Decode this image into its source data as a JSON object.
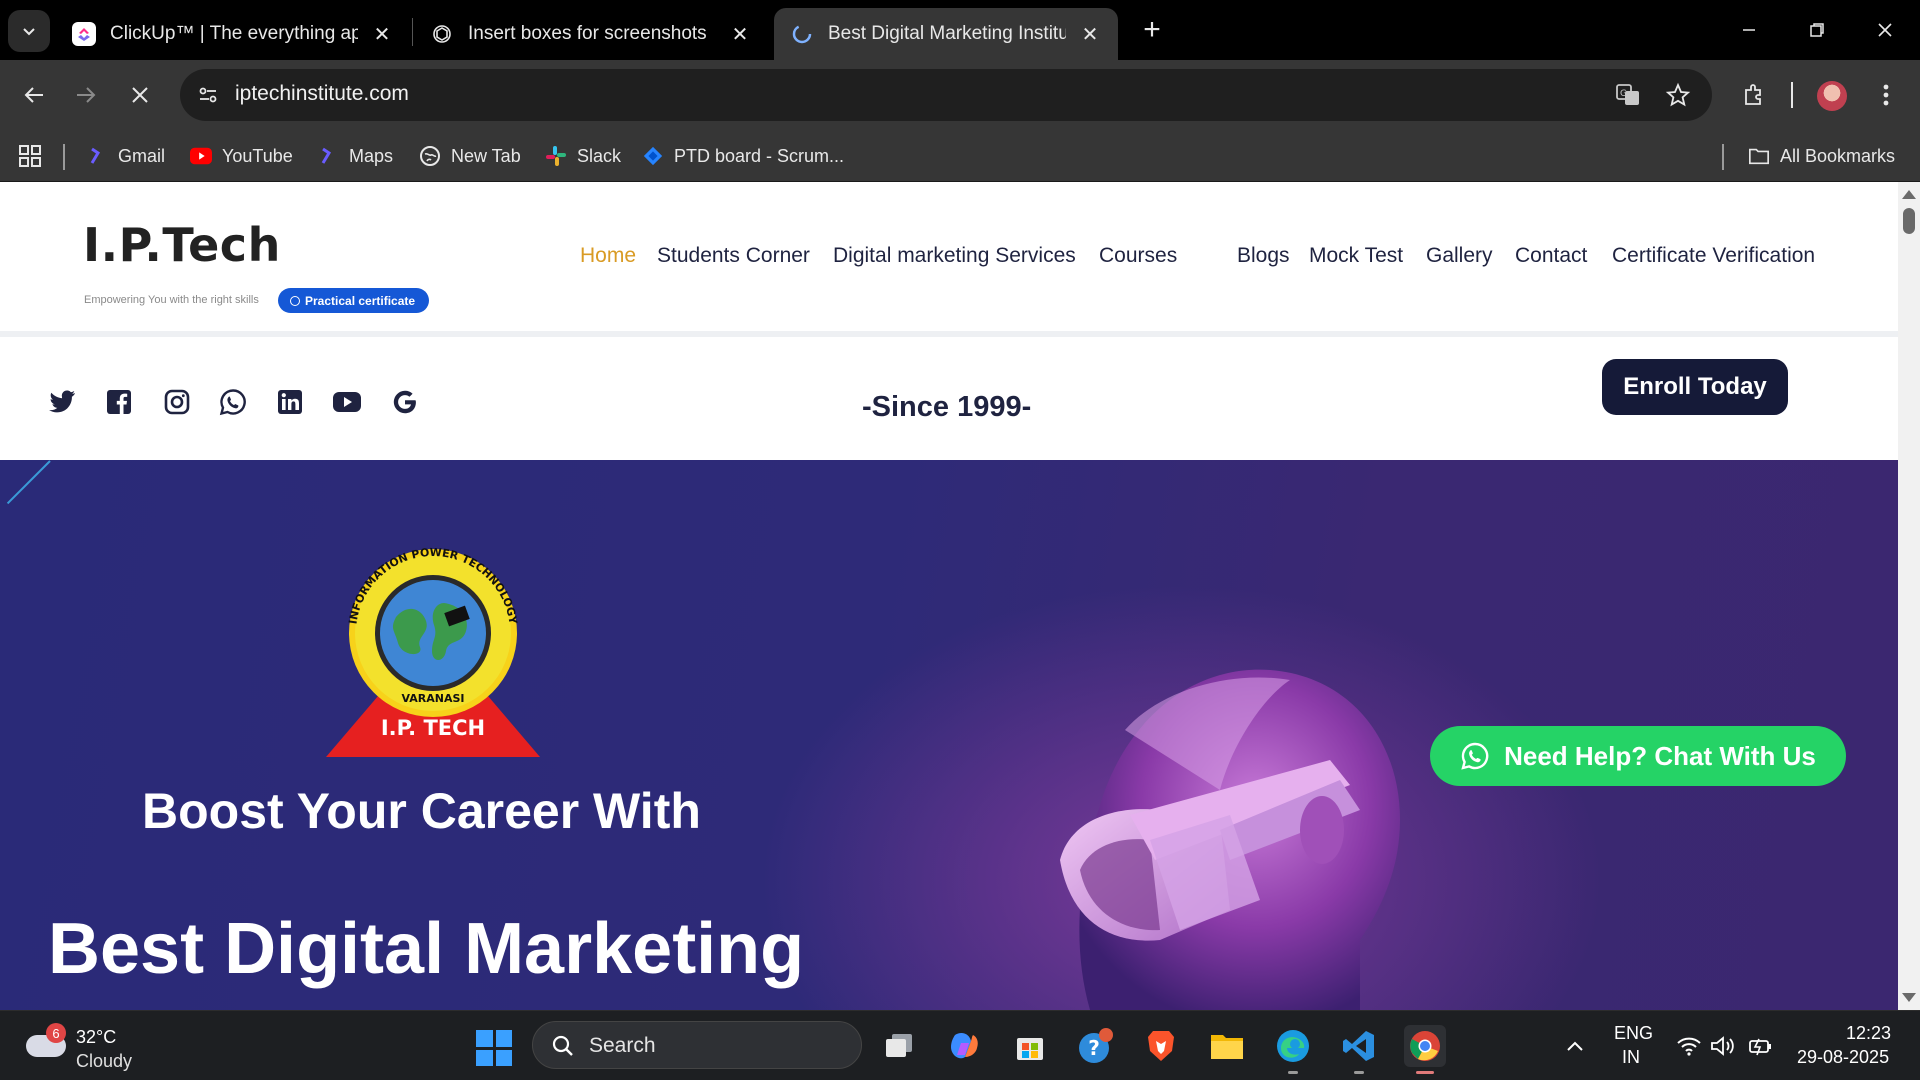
{
  "browser": {
    "tabs": [
      {
        "title": "ClickUp™ | The everything app f",
        "active": false
      },
      {
        "title": "Insert boxes for screenshots",
        "active": false
      },
      {
        "title": "Best Digital Marketing Institute",
        "active": true
      }
    ],
    "url": "iptechinstitute.com",
    "bookmarks": [
      {
        "label": "Gmail",
        "icon": "gmail-icon"
      },
      {
        "label": "YouTube",
        "icon": "youtube-icon"
      },
      {
        "label": "Maps",
        "icon": "maps-icon"
      },
      {
        "label": "New Tab",
        "icon": "globe-icon"
      },
      {
        "label": "Slack",
        "icon": "slack-icon"
      },
      {
        "label": "PTD board - Scrum...",
        "icon": "jira-icon"
      }
    ],
    "all_bookmarks": "All Bookmarks"
  },
  "site": {
    "logo": "I.P.Tech",
    "tagline": "Empowering You with the right skills",
    "badge": "Practical certificate",
    "nav": [
      {
        "label": "Home",
        "active": true
      },
      {
        "label": "Students Corner"
      },
      {
        "label": "Digital marketing Services"
      },
      {
        "label": "Courses"
      },
      {
        "label": "Blogs"
      },
      {
        "label": "Mock Test"
      },
      {
        "label": "Gallery"
      },
      {
        "label": "Contact"
      },
      {
        "label": "Certificate Verification"
      }
    ],
    "since": "-Since 1999-",
    "enroll": "Enroll Today",
    "social_icons": [
      "twitter-icon",
      "facebook-icon",
      "instagram-icon",
      "whatsapp-icon",
      "linkedin-icon",
      "youtube-icon",
      "google-icon"
    ]
  },
  "hero": {
    "emblem_ring_text": "INFORMATION POWER TECHNOLOGY",
    "emblem_city": "VARANASI",
    "emblem_name": "I.P. TECH",
    "heading_small": "Boost Your Career With",
    "heading_large": "Best Digital Marketing",
    "chat_button": "Need Help? Chat With Us"
  },
  "taskbar": {
    "weather_badge": "6",
    "temperature": "32°C",
    "condition": "Cloudy",
    "search_placeholder": "Search",
    "lang_top": "ENG",
    "lang_bottom": "IN",
    "time": "12:23",
    "date": "29-08-2025"
  },
  "colors": {
    "accent_nav": "#d99b24",
    "enroll_bg": "#151a38",
    "chat_green": "#25d366",
    "hero_bg": "#2e2a78"
  }
}
